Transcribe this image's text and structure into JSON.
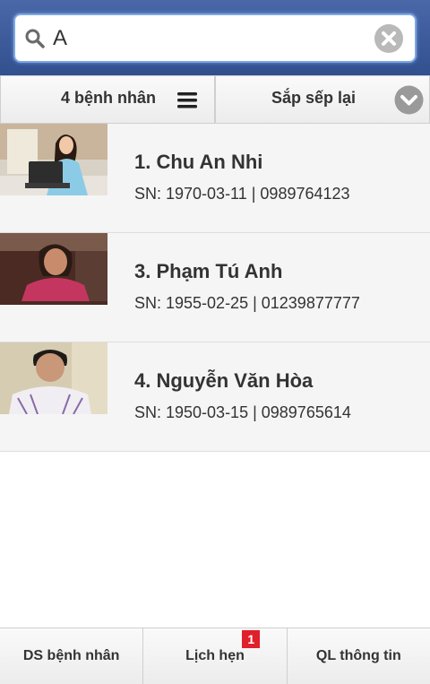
{
  "search": {
    "value": "A",
    "icon": "search-icon",
    "clear_icon": "clear-icon"
  },
  "toolbar": {
    "count_label": "4 bệnh nhân",
    "menu_icon": "menu-icon",
    "sort_label": "Sắp sếp lại",
    "sort_icon": "chevron-down-icon"
  },
  "patients": [
    {
      "name": "1.  Chu An Nhi",
      "info": "SN:  1970-03-11  |  0989764123"
    },
    {
      "name": "3.  Phạm Tú Anh",
      "info": "SN:  1955-02-25  |  01239877777"
    },
    {
      "name": "4.  Nguyễn Văn Hòa",
      "info": "SN:  1950-03-15  |  0989765614"
    }
  ],
  "bottom_nav": [
    {
      "label": "DS bệnh nhân"
    },
    {
      "label": "Lịch hẹn",
      "badge": "1"
    },
    {
      "label": "QL thông tin"
    }
  ],
  "colors": {
    "header": "#3c5a99",
    "badge": "#e0202a"
  }
}
